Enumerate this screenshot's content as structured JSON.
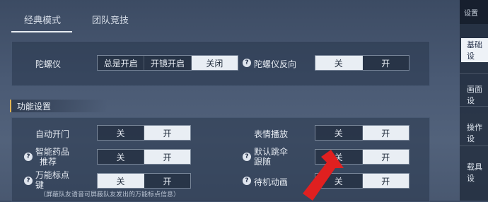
{
  "tabs": [
    {
      "label": "经典模式",
      "active": true
    },
    {
      "label": "团队竞技",
      "active": false
    }
  ],
  "gyro": {
    "label": "陀螺仪",
    "options": [
      "总是开启",
      "开镜开启",
      "关闭"
    ],
    "selected": "关闭"
  },
  "gyro_reverse": {
    "label": "陀螺仪反向",
    "options": [
      "关",
      "开"
    ],
    "selected": "关"
  },
  "section": {
    "title": "功能设置"
  },
  "auto_door": {
    "label": "自动开门",
    "options": [
      "关",
      "开"
    ],
    "selected": "开"
  },
  "emote": {
    "label": "表情播放",
    "options": [
      "关",
      "开"
    ],
    "selected": "开"
  },
  "smart_med": {
    "label_line1": "智能药品",
    "label_line2": "推荐",
    "options": [
      "关",
      "开"
    ],
    "selected": "开"
  },
  "parachute": {
    "label_line1": "默认跳伞",
    "label_line2": "跟随",
    "options": [
      "关",
      "开"
    ],
    "selected": "开"
  },
  "marker": {
    "label_line1": "万能标点",
    "label_line2": "键",
    "options": [
      "关",
      "开"
    ],
    "selected": "关"
  },
  "idle": {
    "label": "待机动画",
    "options": [
      "关",
      "开"
    ],
    "selected": "开"
  },
  "hint": "（屏蔽队友语音可屏蔽队友发出的万能标点信息）",
  "side": {
    "title": "设置",
    "items": [
      "基础设",
      "画面设",
      "操作设",
      "载具设"
    ],
    "active": "基础设"
  },
  "colors": {
    "accent": "#e0b455",
    "arrow": "#e02020",
    "selected_bg": "#e9eef4"
  }
}
